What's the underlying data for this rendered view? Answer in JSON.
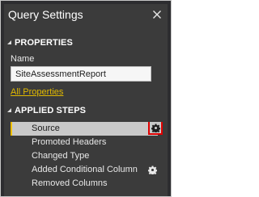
{
  "panel": {
    "title": "Query Settings",
    "close_icon": "close-icon"
  },
  "properties": {
    "heading": "PROPERTIES",
    "name_label": "Name",
    "name_value": "SiteAssessmentReport",
    "all_properties_link": "All Properties"
  },
  "applied_steps": {
    "heading": "APPLIED STEPS",
    "selected_index": 0,
    "items": [
      {
        "label": "Source",
        "has_gear": true
      },
      {
        "label": "Promoted Headers",
        "has_gear": false
      },
      {
        "label": "Changed Type",
        "has_gear": false
      },
      {
        "label": "Added Conditional Column",
        "has_gear": true
      },
      {
        "label": "Removed Columns",
        "has_gear": false
      }
    ]
  },
  "colors": {
    "panel_background": "#3b3b3b",
    "selected_step_background": "#c9c9c9",
    "link_color": "#e1b900",
    "highlight_border": "#e00000"
  }
}
